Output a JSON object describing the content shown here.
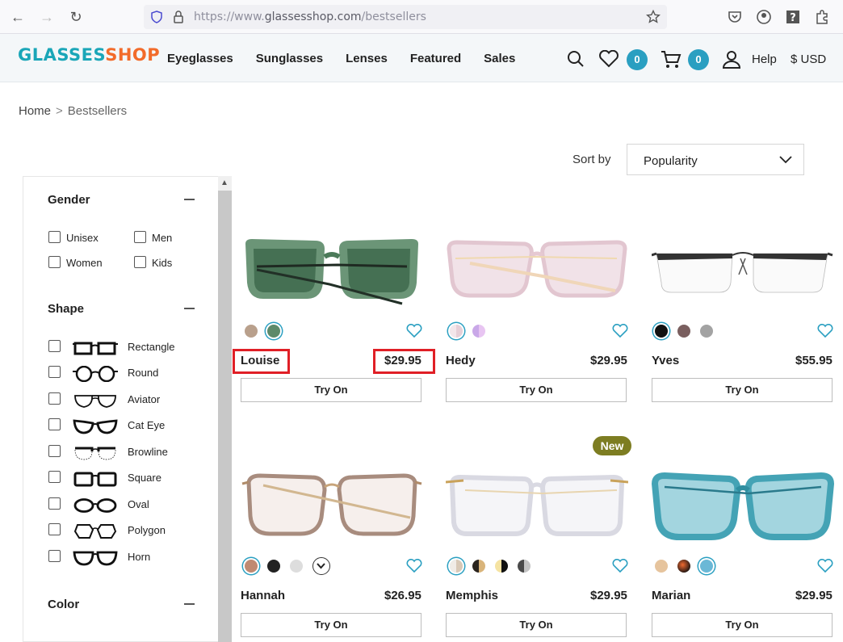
{
  "browser": {
    "url_scheme": "https://www.",
    "url_host": "glassesshop.com",
    "url_path": "/bestsellers"
  },
  "header": {
    "logo": {
      "first": "GLASSES",
      "second": "SHOP"
    },
    "nav": [
      "Eyeglasses",
      "Sunglasses",
      "Lenses",
      "Featured",
      "Sales"
    ],
    "wishlist_count": "0",
    "cart_count": "0",
    "help": "Help",
    "currency": "$ USD"
  },
  "breadcrumb": {
    "home": "Home",
    "separator": ">",
    "current": "Bestsellers"
  },
  "sort": {
    "label": "Sort by",
    "value": "Popularity"
  },
  "filters": {
    "gender": {
      "title": "Gender",
      "options": [
        "Unisex",
        "Men",
        "Women",
        "Kids"
      ]
    },
    "shape": {
      "title": "Shape",
      "options": [
        "Rectangle",
        "Round",
        "Aviator",
        "Cat Eye",
        "Browline",
        "Square",
        "Oval",
        "Polygon",
        "Horn"
      ]
    },
    "color": {
      "title": "Color"
    }
  },
  "products": [
    {
      "name": "Louise",
      "price": "$29.95",
      "try_on": "Try On",
      "frame_color": "#4f7a5c",
      "swatches": [
        "#b9a08c",
        "#5e8a6a"
      ],
      "selected": 1
    },
    {
      "name": "Hedy",
      "price": "$29.95",
      "try_on": "Try On",
      "frame_color": "#e6cfd7",
      "swatches": [
        "#ecdde2",
        "#c9a8e8"
      ],
      "selected": 0
    },
    {
      "name": "Yves",
      "price": "$55.95",
      "try_on": "Try On",
      "frame_color": "#333333",
      "swatches": [
        "#111111",
        "#7a5f5f",
        "#a3a3a3"
      ],
      "selected": 0
    },
    {
      "name": "Hannah",
      "price": "$26.95",
      "try_on": "Try On",
      "frame_color": "#a6887a",
      "swatches": [
        "#c08a72",
        "#222222",
        "#dddddd"
      ],
      "selected": 0
    },
    {
      "name": "Memphis",
      "price": "$29.95",
      "try_on": "Try On",
      "frame_color": "#d9d9e0",
      "swatches": [
        "#e8e0d6",
        "#c9a25a",
        "#e4b844",
        "#8a8a8a"
      ],
      "selected": 0,
      "tag": "New"
    },
    {
      "name": "Marian",
      "price": "$29.95",
      "try_on": "Try On",
      "frame_color": "#3a9fb2",
      "swatches": [
        "#e6c49d",
        "#d2452a",
        "#6bb8d6"
      ],
      "selected": 2
    }
  ]
}
